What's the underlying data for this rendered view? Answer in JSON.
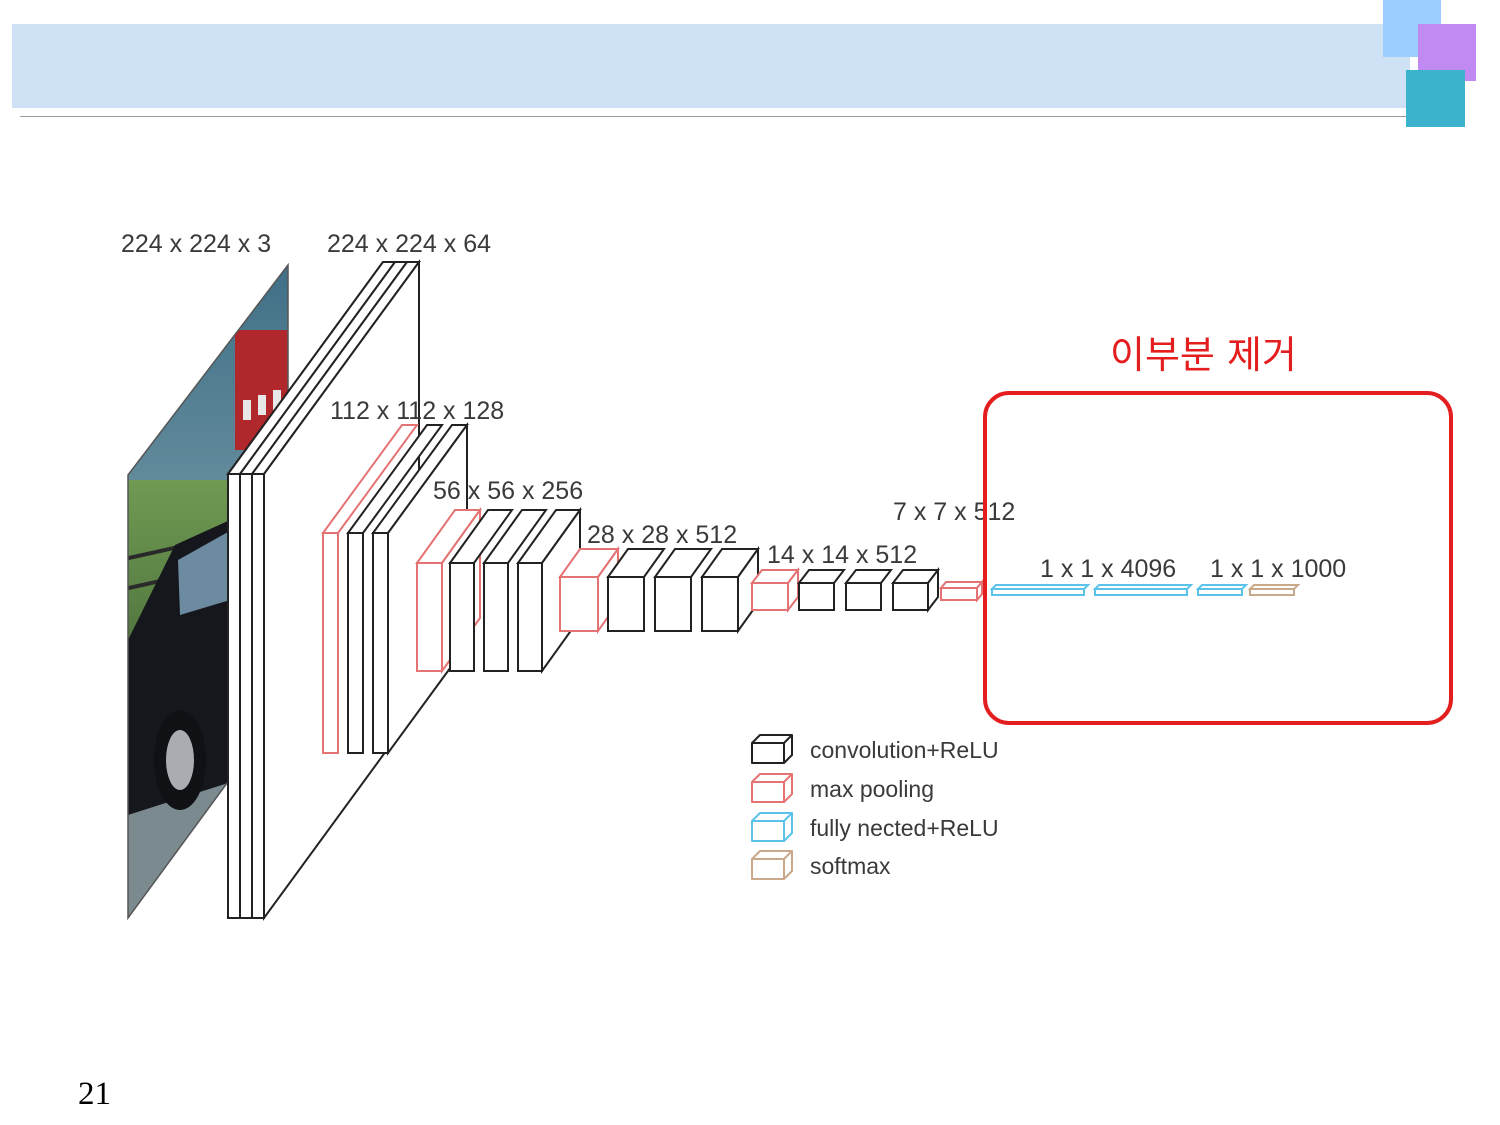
{
  "slide": {
    "page_number": "21",
    "accent_colors": {
      "header_band": "#cfe2f5",
      "square_1": "#9ccfff",
      "square_2": "#c08af2",
      "square_3": "#3cb3cc"
    }
  },
  "diagram": {
    "input_label": "224 x 224 x 3",
    "stages": [
      {
        "label": "224 x 224 x 64",
        "layers": [
          "conv",
          "conv"
        ]
      },
      {
        "label": "112 x 112 x 128",
        "layers": [
          "pool",
          "conv",
          "conv"
        ]
      },
      {
        "label": "56 x 56 x 256",
        "layers": [
          "pool",
          "conv",
          "conv",
          "conv"
        ]
      },
      {
        "label": "28 x 28 x 512",
        "layers": [
          "pool",
          "conv",
          "conv",
          "conv"
        ]
      },
      {
        "label": "14 x 14 x 512",
        "layers": [
          "pool",
          "conv",
          "conv",
          "conv"
        ]
      },
      {
        "label": "7 x 7 x 512",
        "layers": [
          "pool"
        ]
      },
      {
        "label": "1 x 1 x 4096",
        "layers": [
          "fc",
          "fc"
        ]
      },
      {
        "label": "1 x 1 x 1000",
        "layers": [
          "fc",
          "softmax"
        ]
      }
    ],
    "layer_colors": {
      "conv": "#222222",
      "pool": "#e57373",
      "fc": "#5bc2ea",
      "softmax": "#c9a98a"
    },
    "legend": [
      {
        "type": "conv",
        "label": "convolution+ReLU"
      },
      {
        "type": "pool",
        "label": "max pooling"
      },
      {
        "type": "fc",
        "label": "fully nected+ReLU"
      },
      {
        "type": "softmax",
        "label": "softmax"
      }
    ],
    "annotation": {
      "text": "이부분 제거",
      "color": "#e41e1e"
    }
  }
}
